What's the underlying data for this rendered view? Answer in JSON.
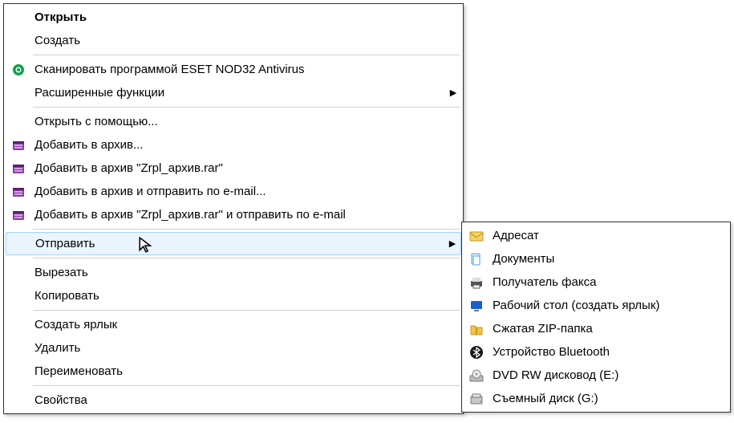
{
  "main_menu": {
    "open": "Открыть",
    "create": "Создать",
    "scan_eset": "Сканировать программой ESET NOD32 Antivirus",
    "advanced_functions": "Расширенные функции",
    "open_with": "Открыть с помощью...",
    "add_to_archive": "Добавить в архив...",
    "add_to_named_archive": "Добавить в архив \"Zrpl_архив.rar\"",
    "archive_and_email": "Добавить в архив и отправить по e-mail...",
    "archive_named_and_email": "Добавить в архив \"Zrpl_архив.rar\" и отправить по e-mail",
    "send_to": "Отправить",
    "cut": "Вырезать",
    "copy": "Копировать",
    "create_shortcut": "Создать ярлык",
    "delete": "Удалить",
    "rename": "Переименовать",
    "properties": "Свойства"
  },
  "sub_menu": {
    "recipient": "Адресат",
    "documents": "Документы",
    "fax_recipient": "Получатель факса",
    "desktop_shortcut": "Рабочий стол (создать ярлык)",
    "compressed_zip": "Сжатая ZIP-папка",
    "bluetooth_device": "Устройство Bluetooth",
    "dvd_rw_drive": "DVD RW дисковод (E:)",
    "removable_disk": "Съемный диск (G:)"
  }
}
